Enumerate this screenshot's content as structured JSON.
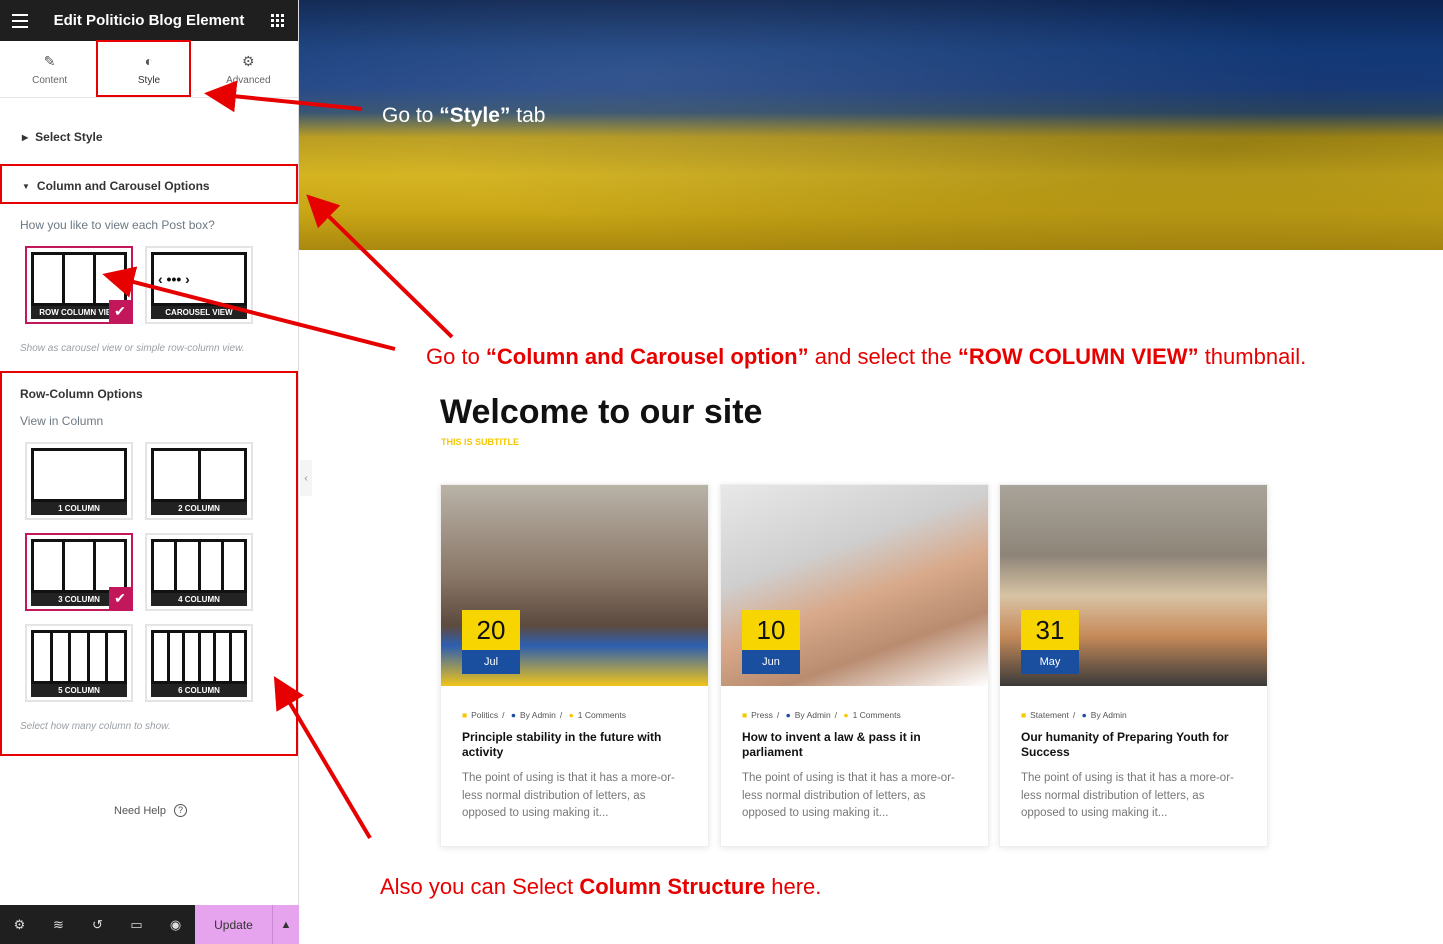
{
  "sidebar": {
    "title": "Edit Politicio Blog Element",
    "tabs": [
      {
        "label": "Content"
      },
      {
        "label": "Style"
      },
      {
        "label": "Advanced"
      }
    ],
    "select_style": "Select Style",
    "column_carousel": "Column and Carousel Options",
    "view_question": "How you like to view each Post box?",
    "view_options": [
      "ROW COLUMN VIEW",
      "CAROUSEL VIEW"
    ],
    "view_note": "Show as carousel view or simple row-column view.",
    "row_column_options": "Row-Column Options",
    "view_in_column": "View in Column",
    "columns": [
      "1 COLUMN",
      "2 COLUMN",
      "3 COLUMN",
      "4 COLUMN",
      "5 COLUMN",
      "6 COLUMN"
    ],
    "column_note": "Select how many column to show.",
    "need_help": "Need Help",
    "update": "Update"
  },
  "annotations": {
    "style_tab": {
      "pre": "Go  to ",
      "bold": "“Style”",
      "post": " tab"
    },
    "column_option": {
      "a": "Go to ",
      "b": "“Column and Carousel option”",
      "c": " and select the ",
      "d": "“ROW COLUMN VIEW”",
      "e": " thumbnail."
    },
    "structure": {
      "a": "Also you can Select ",
      "b": "Column Structure",
      "c": " here."
    }
  },
  "section": {
    "title": "Welcome to our site",
    "subtitle": "THIS IS SUBTITLE"
  },
  "cards": [
    {
      "day": "20",
      "month": "Jul",
      "category": "Politics",
      "author": "By Admin",
      "comments": "1 Comments",
      "title": "Principle stability in the future with activity",
      "excerpt": "The point of using is that it has a more-or-less normal distribution of letters, as opposed to using making it..."
    },
    {
      "day": "10",
      "month": "Jun",
      "category": "Press",
      "author": "By Admin",
      "comments": "1 Comments",
      "title": "How to invent a law & pass it in parliament",
      "excerpt": "The point of using is that it has a more-or-less normal distribution of letters, as opposed to using making it..."
    },
    {
      "day": "31",
      "month": "May",
      "category": "Statement",
      "author": "By Admin",
      "comments": "",
      "title": "Our humanity of Preparing Youth for Success",
      "excerpt": "The point of using is that it has a more-or-less normal distribution of letters, as opposed to using making it..."
    }
  ],
  "colors": {
    "accent": "#c2185b",
    "annotation": "#e60000",
    "yellow": "#f7d500",
    "blue": "#1a4fa0"
  }
}
